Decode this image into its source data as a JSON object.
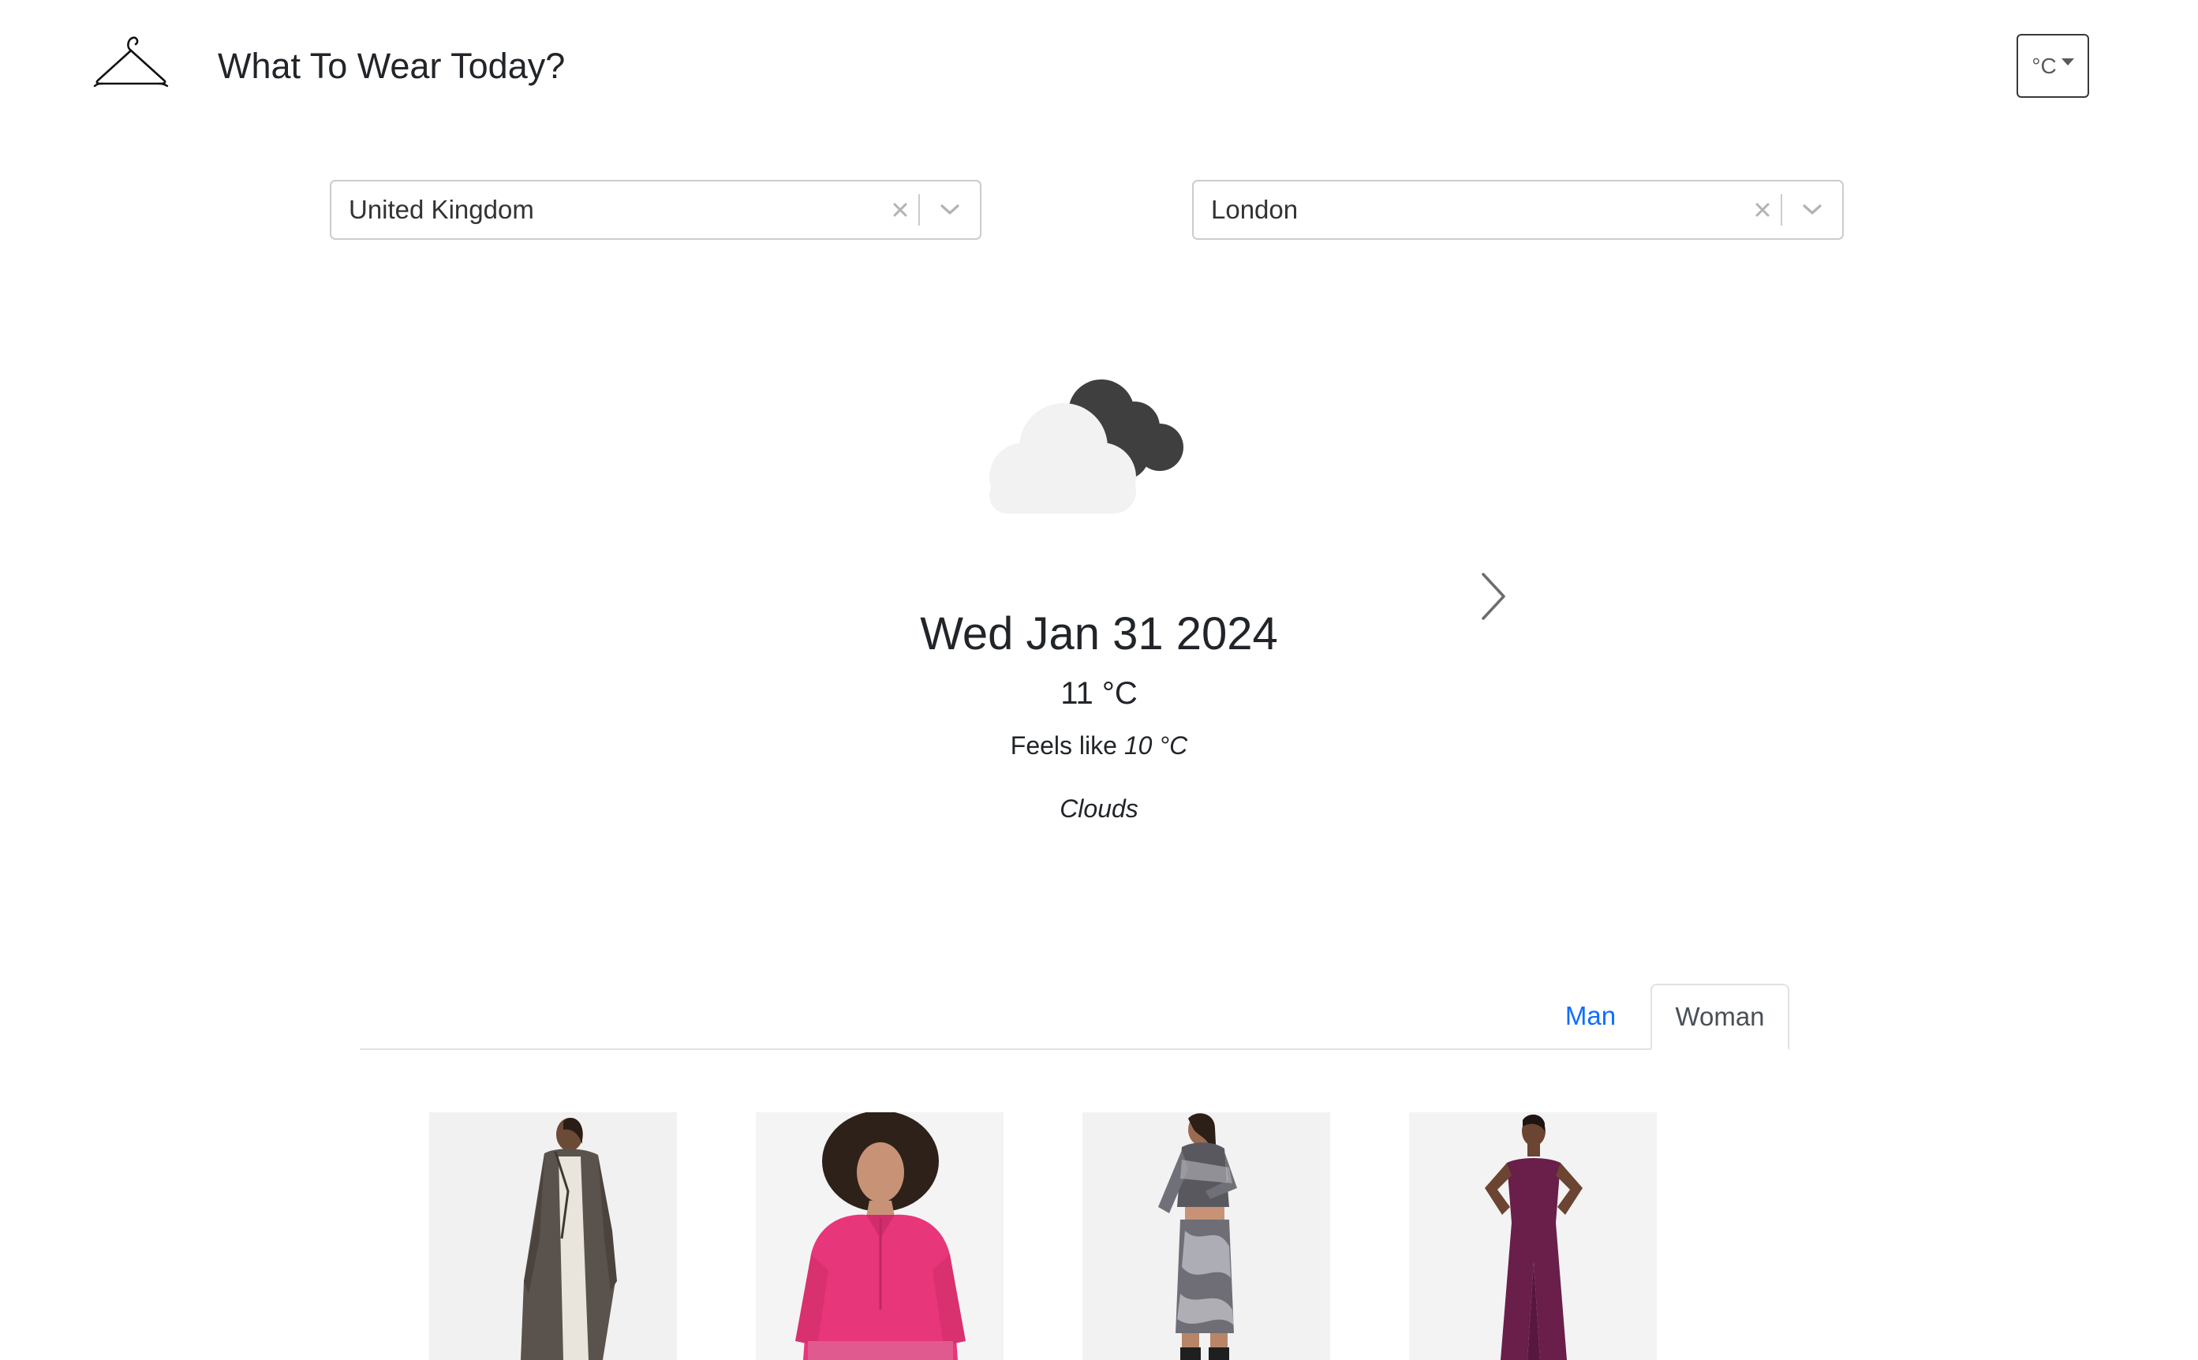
{
  "header": {
    "title": "What To Wear Today?",
    "logo_icon": "hanger-icon"
  },
  "unit_selector": {
    "value": "°C"
  },
  "location": {
    "country": {
      "value": "United Kingdom"
    },
    "city": {
      "value": "London"
    }
  },
  "weather": {
    "icon": "cloudy-night-icon",
    "date": "Wed Jan 31 2024",
    "temperature": "11 °C",
    "feels_like_label": "Feels like",
    "feels_like_value": "10 °C",
    "condition": "Clouds"
  },
  "tabs": {
    "man_label": "Man",
    "woman_label": "Woman",
    "active": "Woman",
    "active_color": "#0d6efd"
  },
  "products": [
    {
      "image": "long-brown-coat-outfit"
    },
    {
      "image": "pink-half-zip-sweater-outfit"
    },
    {
      "image": "printed-mesh-co-ord-outfit"
    },
    {
      "image": "purple-jumpsuit-outfit"
    }
  ]
}
